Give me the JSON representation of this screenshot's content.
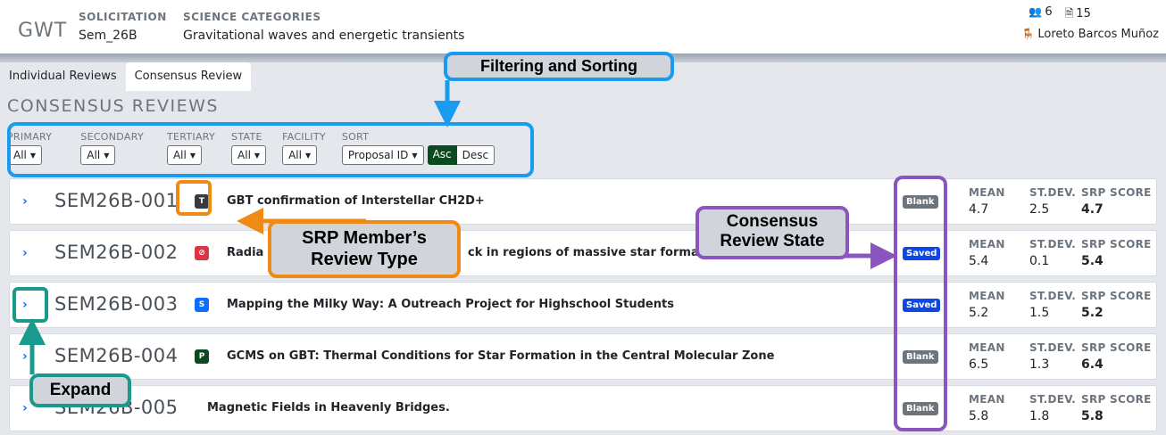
{
  "header": {
    "logo": "GWT",
    "solicitation_label": "SOLICITATION",
    "solicitation_value": "Sem_26B",
    "science_label": "SCIENCE CATEGORIES",
    "science_value": "Gravitational waves and energetic transients",
    "reviewers_count": "6",
    "proposals_count": "15",
    "user_name": "Loreto Barcos Muñoz"
  },
  "tabs": [
    {
      "label": "Individual Reviews"
    },
    {
      "label": "Consensus Review"
    }
  ],
  "section_title": "CONSENSUS REVIEWS",
  "filters": {
    "primary": {
      "label": "PRIMARY",
      "value": "All"
    },
    "secondary": {
      "label": "SECONDARY",
      "value": "All"
    },
    "tertiary": {
      "label": "TERTIARY",
      "value": "All"
    },
    "state": {
      "label": "STATE",
      "value": "All"
    },
    "facility": {
      "label": "FACILITY",
      "value": "All"
    },
    "sort": {
      "label": "SORT",
      "value": "Proposal ID",
      "asc": "Asc",
      "desc": "Desc"
    }
  },
  "stat_labels": {
    "mean": "MEAN",
    "stdev": "ST.DEV.",
    "srp": "SRP SCORE"
  },
  "rows": [
    {
      "id": "SEM26B-001",
      "type": "T",
      "type_color": "#343a40",
      "title": "GBT confirmation of Interstellar CH2D+",
      "state": "Blank",
      "mean": "4.7",
      "stdev": "2.5",
      "srp": "4.7"
    },
    {
      "id": "SEM26B-002",
      "type": "⊘",
      "type_color": "#dc3545",
      "title": "Radia",
      "title_tail": "ck in regions of massive star forma",
      "state": "Saved",
      "mean": "5.4",
      "stdev": "0.1",
      "srp": "5.4"
    },
    {
      "id": "SEM26B-003",
      "type": "S",
      "type_color": "#0d6efd",
      "title": "Mapping the Milky Way: A Outreach Project for Highschool Students",
      "state": "Saved",
      "mean": "5.2",
      "stdev": "1.5",
      "srp": "5.2"
    },
    {
      "id": "SEM26B-004",
      "type": "P",
      "type_color": "#0b4a1f",
      "title": "GCMS on GBT: Thermal Conditions for Star Formation in the Central Molecular Zone",
      "state": "Blank",
      "mean": "6.5",
      "stdev": "1.3",
      "srp": "6.4"
    },
    {
      "id": "SEM26B-005",
      "type": "",
      "type_color": "",
      "title": "Magnetic Fields in Heavenly Bridges.",
      "state": "Blank",
      "mean": "5.8",
      "stdev": "1.8",
      "srp": "5.8"
    }
  ],
  "state_colors": {
    "Blank": "#6c757d",
    "Saved": "#0d47e8"
  },
  "annotations": {
    "filtering": "Filtering and Sorting",
    "consensus_line1": "Consensus",
    "consensus_line2": "Review State",
    "srp_line1": "SRP Member’s",
    "srp_line2": "Review Type",
    "expand": "Expand"
  },
  "annotation_colors": {
    "blue": "#1a9bf0",
    "purple": "#8b55c0",
    "orange": "#f08a16",
    "teal": "#1a9a8c"
  }
}
